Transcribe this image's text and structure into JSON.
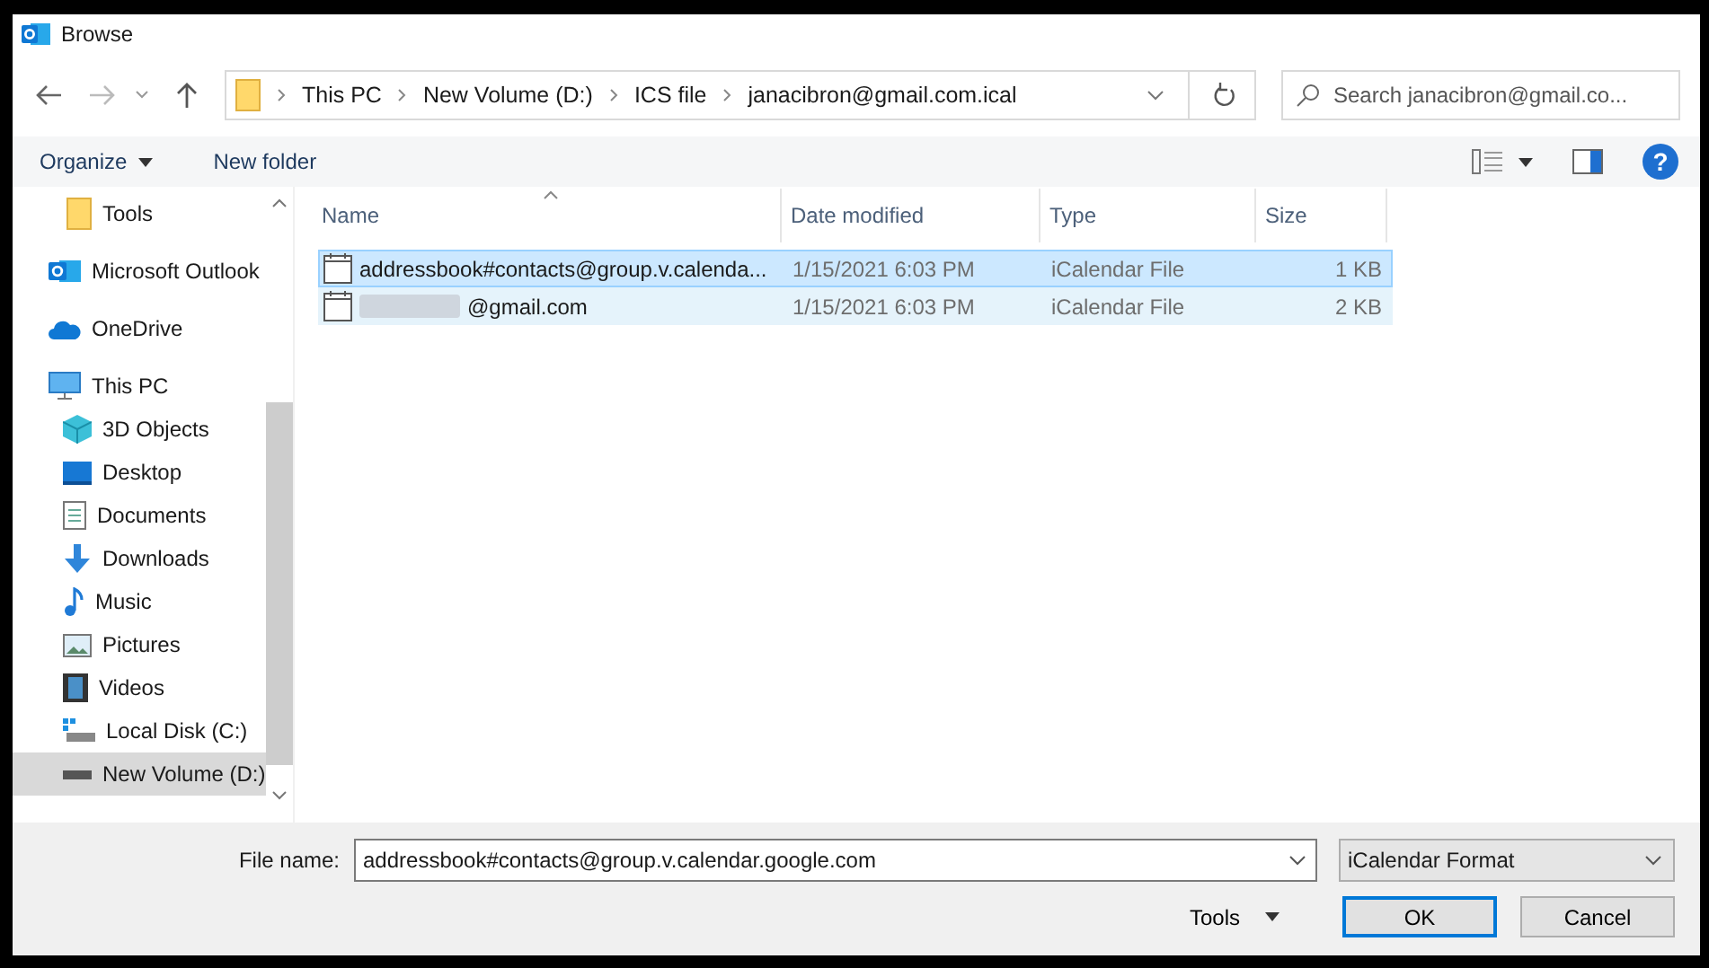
{
  "window": {
    "title": "Browse"
  },
  "address": {
    "crumbs": [
      "This PC",
      "New Volume (D:)",
      "ICS file",
      "janacibron@gmail.com.ical"
    ]
  },
  "search": {
    "placeholder": "Search janacibron@gmail.co..."
  },
  "toolbar": {
    "organize": "Organize",
    "new_folder": "New folder",
    "help": "?"
  },
  "sidebar": {
    "items": [
      {
        "label": "Tools",
        "kind": "folder",
        "selected": false
      },
      {
        "label": "Microsoft Outlook",
        "kind": "outlook",
        "selected": false
      },
      {
        "label": "OneDrive",
        "kind": "cloud",
        "selected": false
      },
      {
        "label": "This PC",
        "kind": "pc",
        "selected": false,
        "children": [
          {
            "label": "3D Objects",
            "kind": "cube",
            "selected": false
          },
          {
            "label": "Desktop",
            "kind": "desktop",
            "selected": false
          },
          {
            "label": "Documents",
            "kind": "document",
            "selected": false
          },
          {
            "label": "Downloads",
            "kind": "download",
            "selected": false
          },
          {
            "label": "Music",
            "kind": "music",
            "selected": false
          },
          {
            "label": "Pictures",
            "kind": "picture",
            "selected": false
          },
          {
            "label": "Videos",
            "kind": "video",
            "selected": false
          },
          {
            "label": "Local Disk (C:)",
            "kind": "disk",
            "selected": false
          },
          {
            "label": "New Volume (D:)",
            "kind": "drive",
            "selected": true
          }
        ]
      }
    ]
  },
  "table": {
    "columns": [
      "Name",
      "Date modified",
      "Type",
      "Size"
    ],
    "rows": [
      {
        "name": "addressbook#contacts@group.v.calenda...",
        "redacted": false,
        "date": "1/15/2021 6:03 PM",
        "type": "iCalendar File",
        "size": "1 KB",
        "selected": true,
        "focused": true
      },
      {
        "name": "@gmail.com",
        "redacted": true,
        "date": "1/15/2021 6:03 PM",
        "type": "iCalendar File",
        "size": "2 KB",
        "selected": true,
        "focused": false
      }
    ]
  },
  "footer": {
    "file_name_label": "File name:",
    "file_name": "addressbook#contacts@group.v.calendar.google.com",
    "file_type": "iCalendar Format",
    "tools": "Tools",
    "ok": "OK",
    "cancel": "Cancel"
  }
}
